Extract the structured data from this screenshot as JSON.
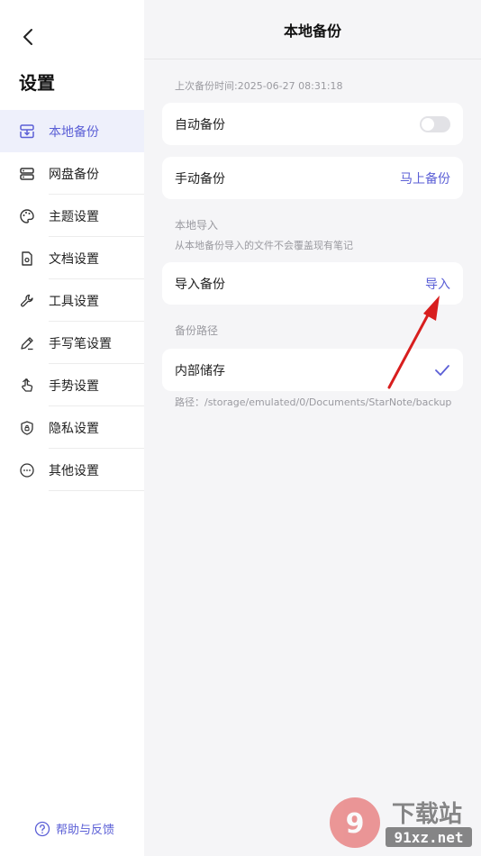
{
  "sidebar": {
    "title": "设置",
    "items": [
      {
        "label": "本地备份",
        "icon": "backup-download-icon"
      },
      {
        "label": "网盘备份",
        "icon": "server-icon"
      },
      {
        "label": "主题设置",
        "icon": "palette-icon"
      },
      {
        "label": "文档设置",
        "icon": "document-gear-icon"
      },
      {
        "label": "工具设置",
        "icon": "wrench-icon"
      },
      {
        "label": "手写笔设置",
        "icon": "pen-icon"
      },
      {
        "label": "手势设置",
        "icon": "hand-pointer-icon"
      },
      {
        "label": "隐私设置",
        "icon": "shield-lock-icon"
      },
      {
        "label": "其他设置",
        "icon": "more-circle-icon"
      }
    ],
    "help": "帮助与反馈"
  },
  "header": {
    "title": "本地备份"
  },
  "main": {
    "last_backup": "上次备份时间:2025-06-27 08:31:18",
    "auto_backup": {
      "label": "自动备份",
      "enabled": false
    },
    "manual_backup": {
      "label": "手动备份",
      "action": "马上备份"
    },
    "import_section": {
      "label": "本地导入",
      "hint": "从本地备份导入的文件不会覆盖现有笔记"
    },
    "import_backup": {
      "label": "导入备份",
      "action": "导入"
    },
    "path_section": {
      "label": "备份路径"
    },
    "internal_storage": {
      "label": "内部储存",
      "selected": true
    },
    "path": "路径：/storage/emulated/0/Documents/StarNote/backup"
  },
  "colors": {
    "accent": "#5b5fd6",
    "annotation_arrow": "#d81e1e"
  },
  "watermark": {
    "brand": "下载站",
    "site": "91xz.net"
  }
}
